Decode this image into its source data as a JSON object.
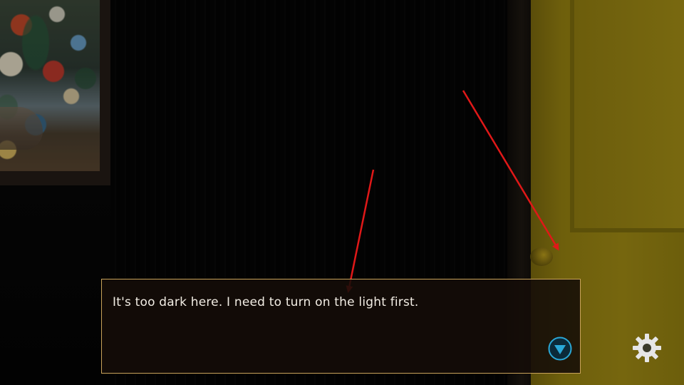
{
  "dialog": {
    "text": "It's too dark here. I need to turn on the light first."
  },
  "icons": {
    "next": "next-arrow-icon",
    "settings": "gear-icon",
    "hint_arrows": "red-arrow-icon"
  },
  "colors": {
    "dialog_border": "#c9a35a",
    "dialog_text": "#f2ede4",
    "next_button": "#2aa8d8",
    "settings_gear": "#e6e6e6",
    "hint_arrow": "#e01818",
    "lit_door": "#76660e"
  }
}
